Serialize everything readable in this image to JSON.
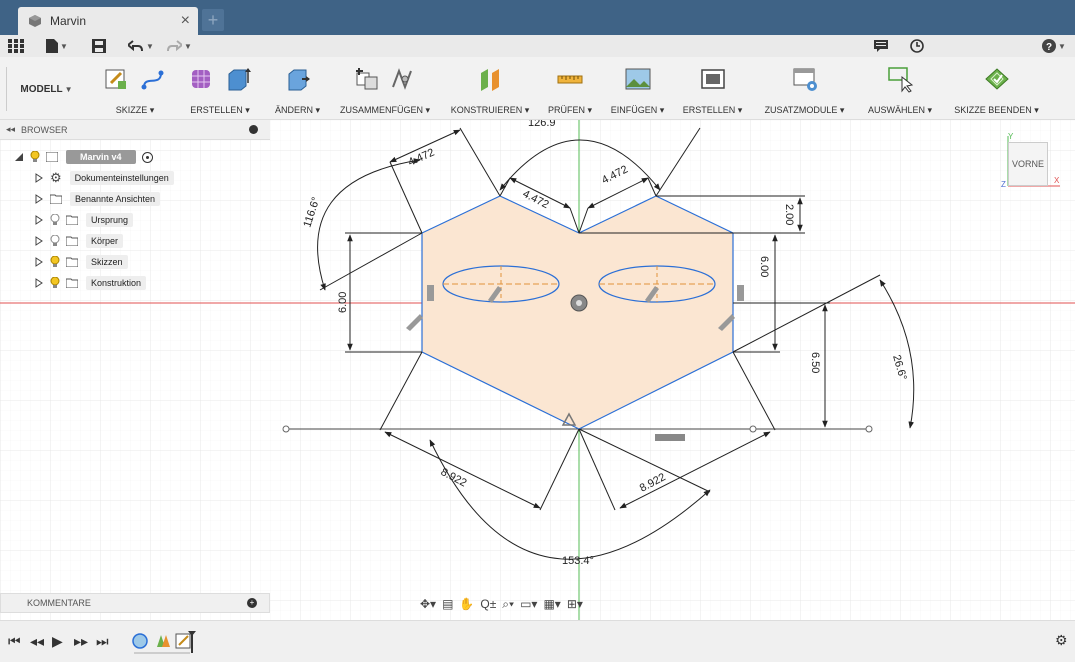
{
  "window": {
    "tab_title": "Marvin",
    "tab_close": "×",
    "new_tab": "+"
  },
  "ribbon": {
    "workspace": "MODELL",
    "groups": [
      {
        "label": "SKIZZE ▾"
      },
      {
        "label": "ERSTELLEN ▾"
      },
      {
        "label": "ÄNDERN ▾"
      },
      {
        "label": "ZUSAMMENFÜGEN ▾"
      },
      {
        "label": "KONSTRUIEREN ▾"
      },
      {
        "label": "PRÜFEN ▾"
      },
      {
        "label": "EINFÜGEN ▾"
      },
      {
        "label": "ERSTELLEN ▾"
      },
      {
        "label": "ZUSATZMODULE ▾"
      },
      {
        "label": "AUSWÄHLEN ▾"
      },
      {
        "label": "SKIZZE BEENDEN ▾"
      }
    ]
  },
  "browser": {
    "title": "BROWSER",
    "root": "Marvin v4",
    "items": [
      {
        "label": "Dokumenteinstellungen"
      },
      {
        "label": "Benannte Ansichten"
      },
      {
        "label": "Ursprung"
      },
      {
        "label": "Körper"
      },
      {
        "label": "Skizzen"
      },
      {
        "label": "Konstruktion"
      }
    ]
  },
  "comments": {
    "title": "KOMMENTARE",
    "add": "+"
  },
  "viewcube": {
    "face": "VORNE",
    "axis_x": "X",
    "axis_y": "Y",
    "axis_z": "Z"
  },
  "dimensions": {
    "top_angle": "126.9",
    "left_angle": "116.6°",
    "right_angle": "26.6°",
    "bottom_angle": "153.4°",
    "left_edge": "4.472",
    "notch_left": "4.472",
    "notch_right": "4.472",
    "notch_height": "2.00",
    "left_height": "6.00",
    "right_height": "6.00",
    "right_offset": "6.50",
    "bottom_left": "8.922",
    "bottom_right": "8.922"
  },
  "colors": {
    "titlebar": "#3f6386",
    "sketch_fill": "#fbe6d2",
    "sketch_line": "#2b6fd6",
    "axis_red": "#e05050",
    "axis_green": "#55bb55",
    "construction": "#e0933a"
  }
}
